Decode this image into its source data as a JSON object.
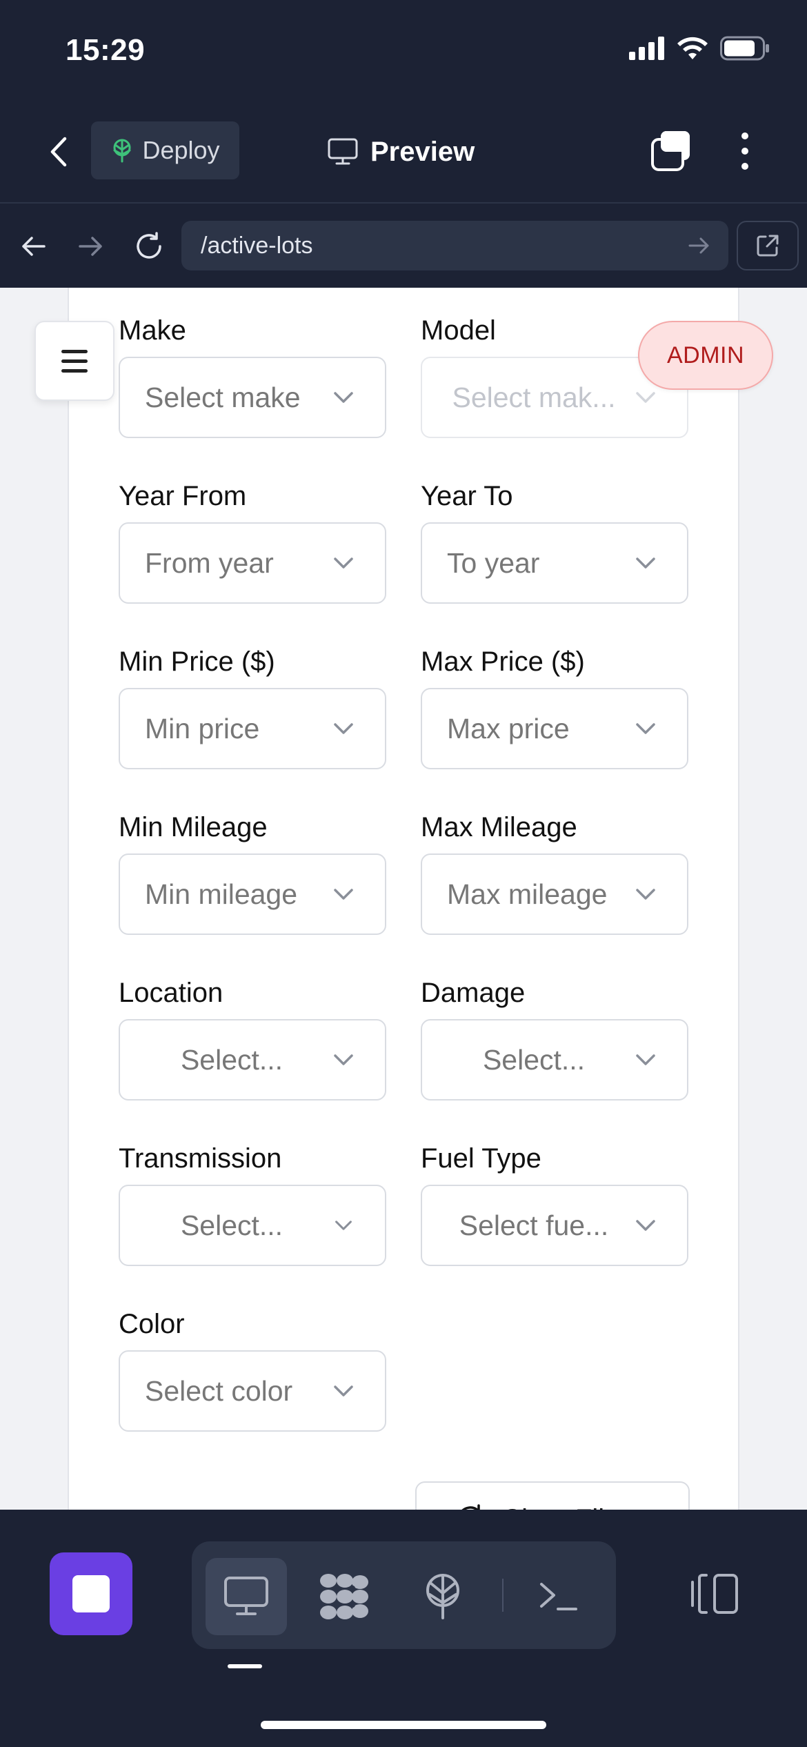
{
  "status_bar": {
    "time": "15:29"
  },
  "header": {
    "deploy_label": "Deploy",
    "preview_label": "Preview"
  },
  "browser": {
    "url": "/active-lots"
  },
  "admin_badge": "ADMIN",
  "filters": [
    {
      "label": "Make",
      "value": "Select make",
      "disabled": false
    },
    {
      "label": "Model",
      "value": "Select mak...",
      "disabled": true
    },
    {
      "label": "Year From",
      "value": "From year",
      "disabled": false
    },
    {
      "label": "Year To",
      "value": "To year",
      "disabled": false
    },
    {
      "label": "Min Price ($)",
      "value": "Min price",
      "disabled": false
    },
    {
      "label": "Max Price ($)",
      "value": "Max price",
      "disabled": false
    },
    {
      "label": "Min Mileage",
      "value": "Min mileage",
      "disabled": false
    },
    {
      "label": "Max Mileage",
      "value": "Max mileage",
      "disabled": false
    },
    {
      "label": "Location",
      "value": "Select...",
      "disabled": false
    },
    {
      "label": "Damage",
      "value": "Select...",
      "disabled": false
    },
    {
      "label": "Transmission",
      "value": "Select...",
      "disabled": false
    },
    {
      "label": "Fuel Type",
      "value": "Select fue...",
      "disabled": false
    },
    {
      "label": "Color",
      "value": "Select color",
      "disabled": false
    }
  ],
  "clear_filters_label": "Clear Filters",
  "colors": {
    "accent": "#6a3fe3",
    "chrome": "#1c2234",
    "admin_text": "#b01c1c",
    "admin_bg": "#fde1e1"
  },
  "icons": {
    "bottom_tools": [
      "desktop-icon",
      "agent-icon",
      "deploy-icon",
      "terminal-icon"
    ],
    "panel": "panel-toggle-icon"
  }
}
